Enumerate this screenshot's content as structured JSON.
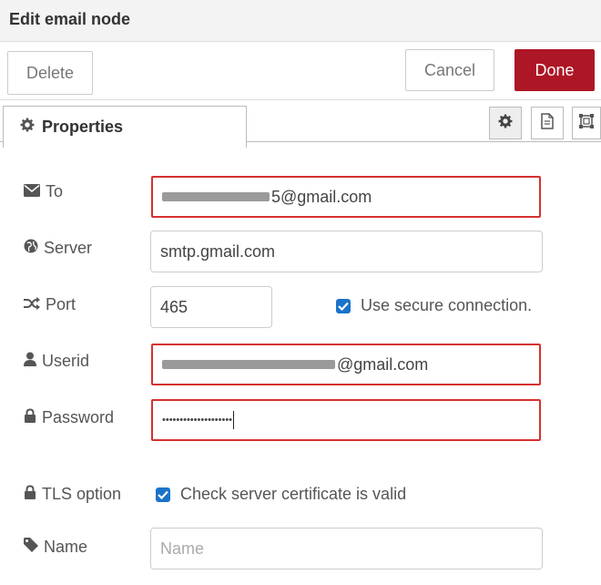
{
  "titlebar": {
    "title": "Edit email node"
  },
  "toolbar": {
    "delete_label": "Delete",
    "cancel_label": "Cancel",
    "done_label": "Done"
  },
  "tabs": {
    "properties_label": "Properties"
  },
  "icons": {
    "properties": "gear-icon",
    "settings_tab": "gear-icon",
    "description_tab": "document-icon",
    "appearance_tab": "frame-icon"
  },
  "colors": {
    "done": "#ad1625",
    "error_border": "#d6312f",
    "checkbox": "#1a73c9"
  },
  "form": {
    "to": {
      "label": "To",
      "value_suffix": "5@gmail.com"
    },
    "server": {
      "label": "Server",
      "value": "smtp.gmail.com"
    },
    "port": {
      "label": "Port",
      "value": "465",
      "secure_label": "Use secure connection.",
      "secure_checked": true
    },
    "userid": {
      "label": "Userid",
      "value_suffix": "@gmail.com"
    },
    "password": {
      "label": "Password",
      "value": "••••••••••••••••••••"
    },
    "tls": {
      "label": "TLS option",
      "check_label": "Check server certificate is valid",
      "checked": true
    },
    "name": {
      "label": "Name",
      "placeholder": "Name",
      "value": ""
    }
  }
}
